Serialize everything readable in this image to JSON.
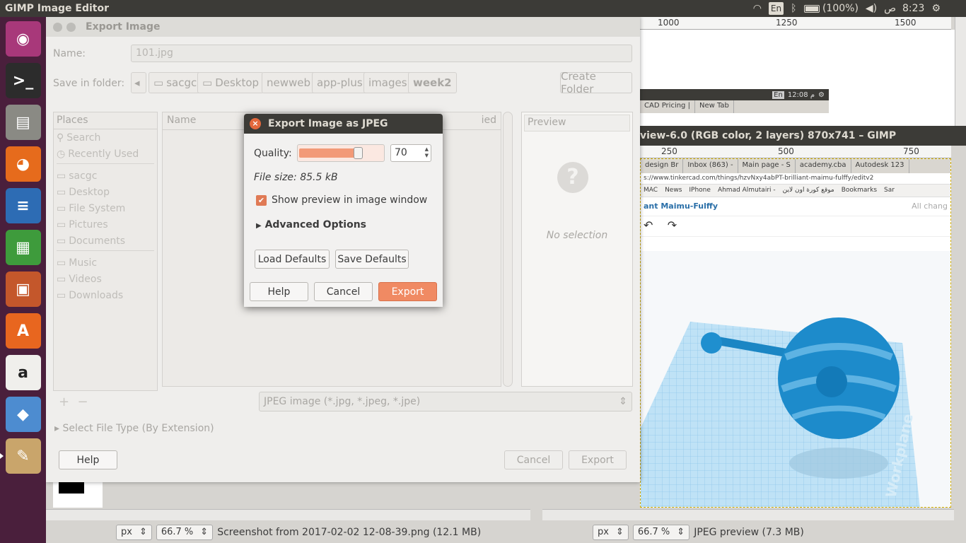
{
  "top_panel": {
    "title": "GIMP Image Editor",
    "lang": "En",
    "battery": "(100%)",
    "time": "8:23",
    "ampm": "ص"
  },
  "launcher": [
    {
      "name": "ubuntu-logo-icon",
      "glyph": "◉",
      "color": "#a8387a"
    },
    {
      "name": "terminal-icon",
      "glyph": ">_",
      "color": "#2c2c2c"
    },
    {
      "name": "files-icon",
      "glyph": "▤",
      "color": "#8a8a84"
    },
    {
      "name": "firefox-icon",
      "glyph": "◕",
      "color": "#e66b1c"
    },
    {
      "name": "writer-icon",
      "glyph": "≡",
      "color": "#2d6cb4"
    },
    {
      "name": "calc-icon",
      "glyph": "▦",
      "color": "#3e9b3c"
    },
    {
      "name": "impress-icon",
      "glyph": "▣",
      "color": "#c4572b"
    },
    {
      "name": "software-center-icon",
      "glyph": "A",
      "color": "#e8661f"
    },
    {
      "name": "amazon-icon",
      "glyph": "a",
      "color": "#f0efec"
    },
    {
      "name": "app-stack-icon",
      "glyph": "◆",
      "color": "#4d8cd0"
    },
    {
      "name": "gimp-icon",
      "glyph": "✎",
      "color": "#c9a56b"
    }
  ],
  "background": {
    "ruler_top": [
      "1000",
      "1250",
      "1500"
    ],
    "mini_time": "12:08 م",
    "mini_lang": "En",
    "mini_tabs": [
      "CAD Pricing |",
      "New Tab"
    ]
  },
  "win2": {
    "title": "view-6.0 (RGB color, 2 layers) 870x741 – GIMP",
    "ruler": [
      "250",
      "500",
      "750"
    ],
    "browser_tabs": [
      "design Br",
      "Inbox (863) -",
      "Main page - S",
      "academy.cba",
      "Autodesk 123"
    ],
    "url": "s://www.tinkercad.com/things/hzvNxy4abPT-brilliant-maimu-fulffy/editv2",
    "bookmarks": [
      "MAC",
      "News",
      "IPhone",
      "Ahmad Almutairi -",
      "موقع كورة اون لاين",
      "Bookmarks",
      "Sar"
    ],
    "heading": "ant Maimu-Fulffy",
    "heading_right": "All chang",
    "workplane_label": "Workplane",
    "status_unit": "px",
    "status_zoom": "66.7 %",
    "status_text": "JPEG preview (7.3 MB)"
  },
  "left_status": {
    "unit": "px",
    "zoom": "66.7 %",
    "text": "Screenshot from 2017-02-02 12-08-39.png (12.1 MB)"
  },
  "export_dialog": {
    "title": "Export Image",
    "name_label": "Name:",
    "name_value": "101.jpg",
    "folder_label": "Save in folder:",
    "crumbs": [
      "sacgc",
      "Desktop",
      "newweb",
      "app-plus",
      "images",
      "week2"
    ],
    "create_folder": "Create Folder",
    "places_header": "Places",
    "places": [
      "Search",
      "Recently Used",
      "sacgc",
      "Desktop",
      "File System",
      "Pictures",
      "Documents",
      "Music",
      "Videos",
      "Downloads"
    ],
    "name_col": "Name",
    "modified_col": "ied",
    "preview_header": "Preview",
    "no_selection": "No selection",
    "file_type": "JPEG image (*.jpg, *.jpeg, *.jpe)",
    "select_type": "Select File Type (By Extension)",
    "help": "Help",
    "cancel": "Cancel",
    "export": "Export"
  },
  "jpeg_dialog": {
    "title": "Export Image as JPEG",
    "quality_label": "Quality:",
    "quality_value": "70",
    "quality": 70,
    "file_size": "File size: 85.5 kB",
    "show_preview": "Show preview in image window",
    "advanced": "Advanced Options",
    "load_defaults": "Load Defaults",
    "save_defaults": "Save Defaults",
    "help": "Help",
    "cancel": "Cancel",
    "export": "Export"
  }
}
